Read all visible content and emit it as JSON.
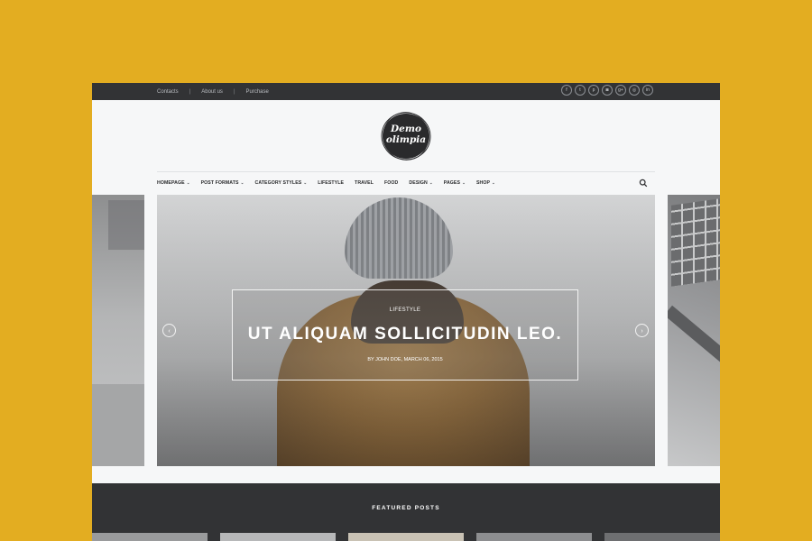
{
  "topbar": {
    "links": [
      "Contacts",
      "About us",
      "Purchase"
    ],
    "separator": "|",
    "social_icons": [
      "facebook-icon",
      "twitter-icon",
      "pinterest-icon",
      "instagram-icon",
      "google-plus-icon",
      "dribbble-icon",
      "linkedin-icon"
    ],
    "social_glyphs": [
      "f",
      "t",
      "p",
      "◙",
      "g+",
      "◎",
      "in"
    ]
  },
  "logo": {
    "line1": "Demo",
    "line2": "olimpia"
  },
  "nav": {
    "items": [
      {
        "label": "HOMEPAGE",
        "has_dropdown": true
      },
      {
        "label": "POST FORMATS",
        "has_dropdown": true
      },
      {
        "label": "CATEGORY STYLES",
        "has_dropdown": true
      },
      {
        "label": "LIFESTYLE",
        "has_dropdown": false
      },
      {
        "label": "TRAVEL",
        "has_dropdown": false
      },
      {
        "label": "FOOD",
        "has_dropdown": false
      },
      {
        "label": "DESIGN",
        "has_dropdown": true
      },
      {
        "label": "PAGES",
        "has_dropdown": true
      },
      {
        "label": "SHOP",
        "has_dropdown": true
      }
    ],
    "chevron": "⌄"
  },
  "slider": {
    "category": "LIFESTYLE",
    "title": "UT ALIQUAM SOLLICITUDIN LEO.",
    "meta": "BY JOHN DOE, MARCH 06, 2015",
    "prev_glyph": "‹",
    "next_glyph": "›"
  },
  "featured": {
    "title": "FEATURED POSTS"
  },
  "colors": {
    "background": "#e3ad21",
    "topbar": "#323335",
    "page": "#f6f7f8",
    "footer_band": "#323335"
  }
}
